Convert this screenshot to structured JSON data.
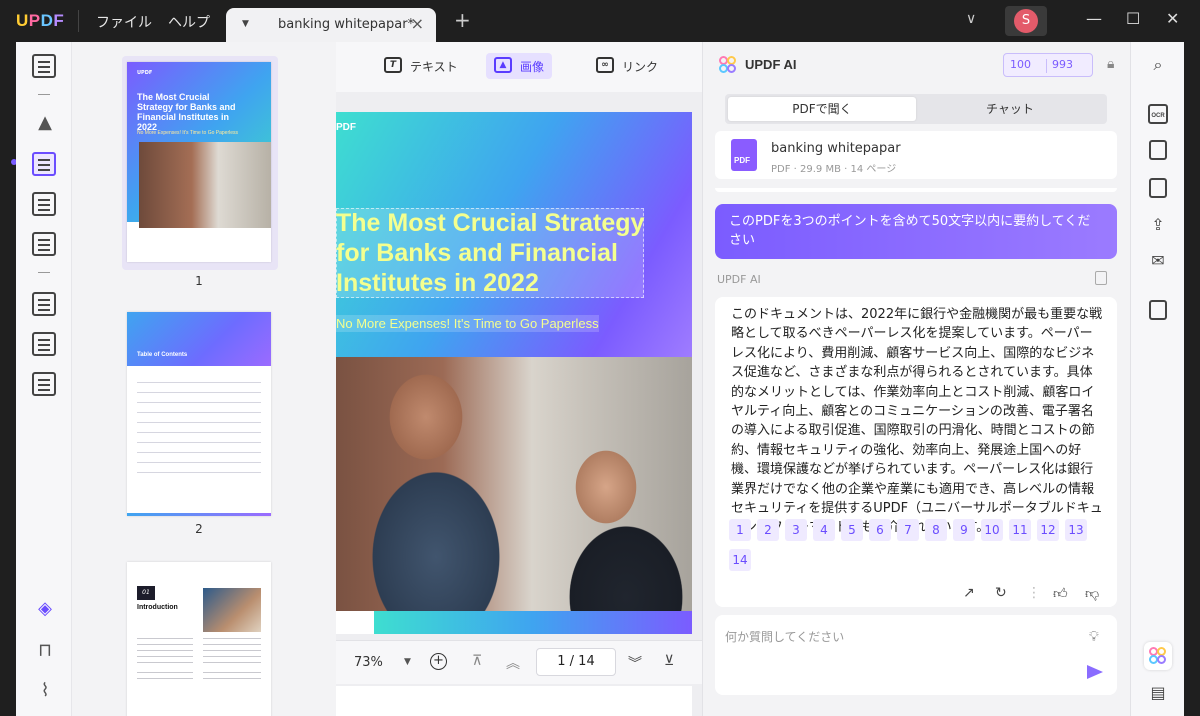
{
  "titlebar": {
    "app_logo": "UPDF",
    "menus": [
      "ファイル",
      "ヘルプ"
    ],
    "tab_title": "banking whitepapar*",
    "avatar_initial": "S"
  },
  "doc_toolbar": {
    "text_label": "テキスト",
    "image_label": "画像",
    "link_label": "リンク"
  },
  "thumbnails": {
    "page1_num": "1",
    "page2_num": "2",
    "page1_title": "The Most Crucial Strategy for Banks and Financial Institutes in 2022",
    "page1_sub": "No More Expenses! It's Time to Go Paperless",
    "page2_title": "Table of Contents",
    "page3_num": "01",
    "page3_title": "Introduction"
  },
  "document": {
    "logo": "PDF",
    "title": "The Most Crucial Strategy for Banks and Financial Institutes in 2022",
    "subtitle": "No More Expenses! It's Time to Go Paperless",
    "zoom": "73%",
    "current_page": "1",
    "total_pages": "14",
    "page_display": "1 / 14"
  },
  "ai_panel": {
    "title": "UPDF AI",
    "credits_a": "100",
    "credits_b": "993",
    "tab_pdf": "PDFで聞く",
    "tab_chat": "チャット",
    "file_name": "banking whitepapar",
    "file_meta": "PDF · 29.9 MB · 14 ページ",
    "user_prompt": "このPDFを3つのポイントを含めて50文字以内に要約してください",
    "ai_label": "UPDF AI",
    "answer": "このドキュメントは、2022年に銀行や金融機関が最も重要な戦略として取るべきペーパーレス化を提案しています。ペーパーレス化により、費用削減、顧客サービス向上、国際的なビジネス促進など、さまざまな利点が得られるとされています。具体的なメリットとしては、作業効率向上とコスト削減、顧客ロイヤルティ向上、顧客とのコミュニケーションの改善、電子署名の導入による取引促進、国際取引の円滑化、時間とコストの節約、情報セキュリティの強化、効率向上、発展途上国への好機、環境保護などが挙げられています。ペーパーレス化は銀行業界だけでなく他の企業や産業にも適用でき、高レベルの情報セキュリティを提供するUPDF（ユニバーサルポータブルドキュメントフォーマット）も紹介されています。",
    "page_refs": [
      "1",
      "2",
      "3",
      "4",
      "5",
      "6",
      "7",
      "8",
      "9",
      "10",
      "11",
      "12",
      "13",
      "14"
    ],
    "ask_placeholder": "何か質問してください"
  },
  "icons": {
    "accent": "#7b5cff"
  }
}
